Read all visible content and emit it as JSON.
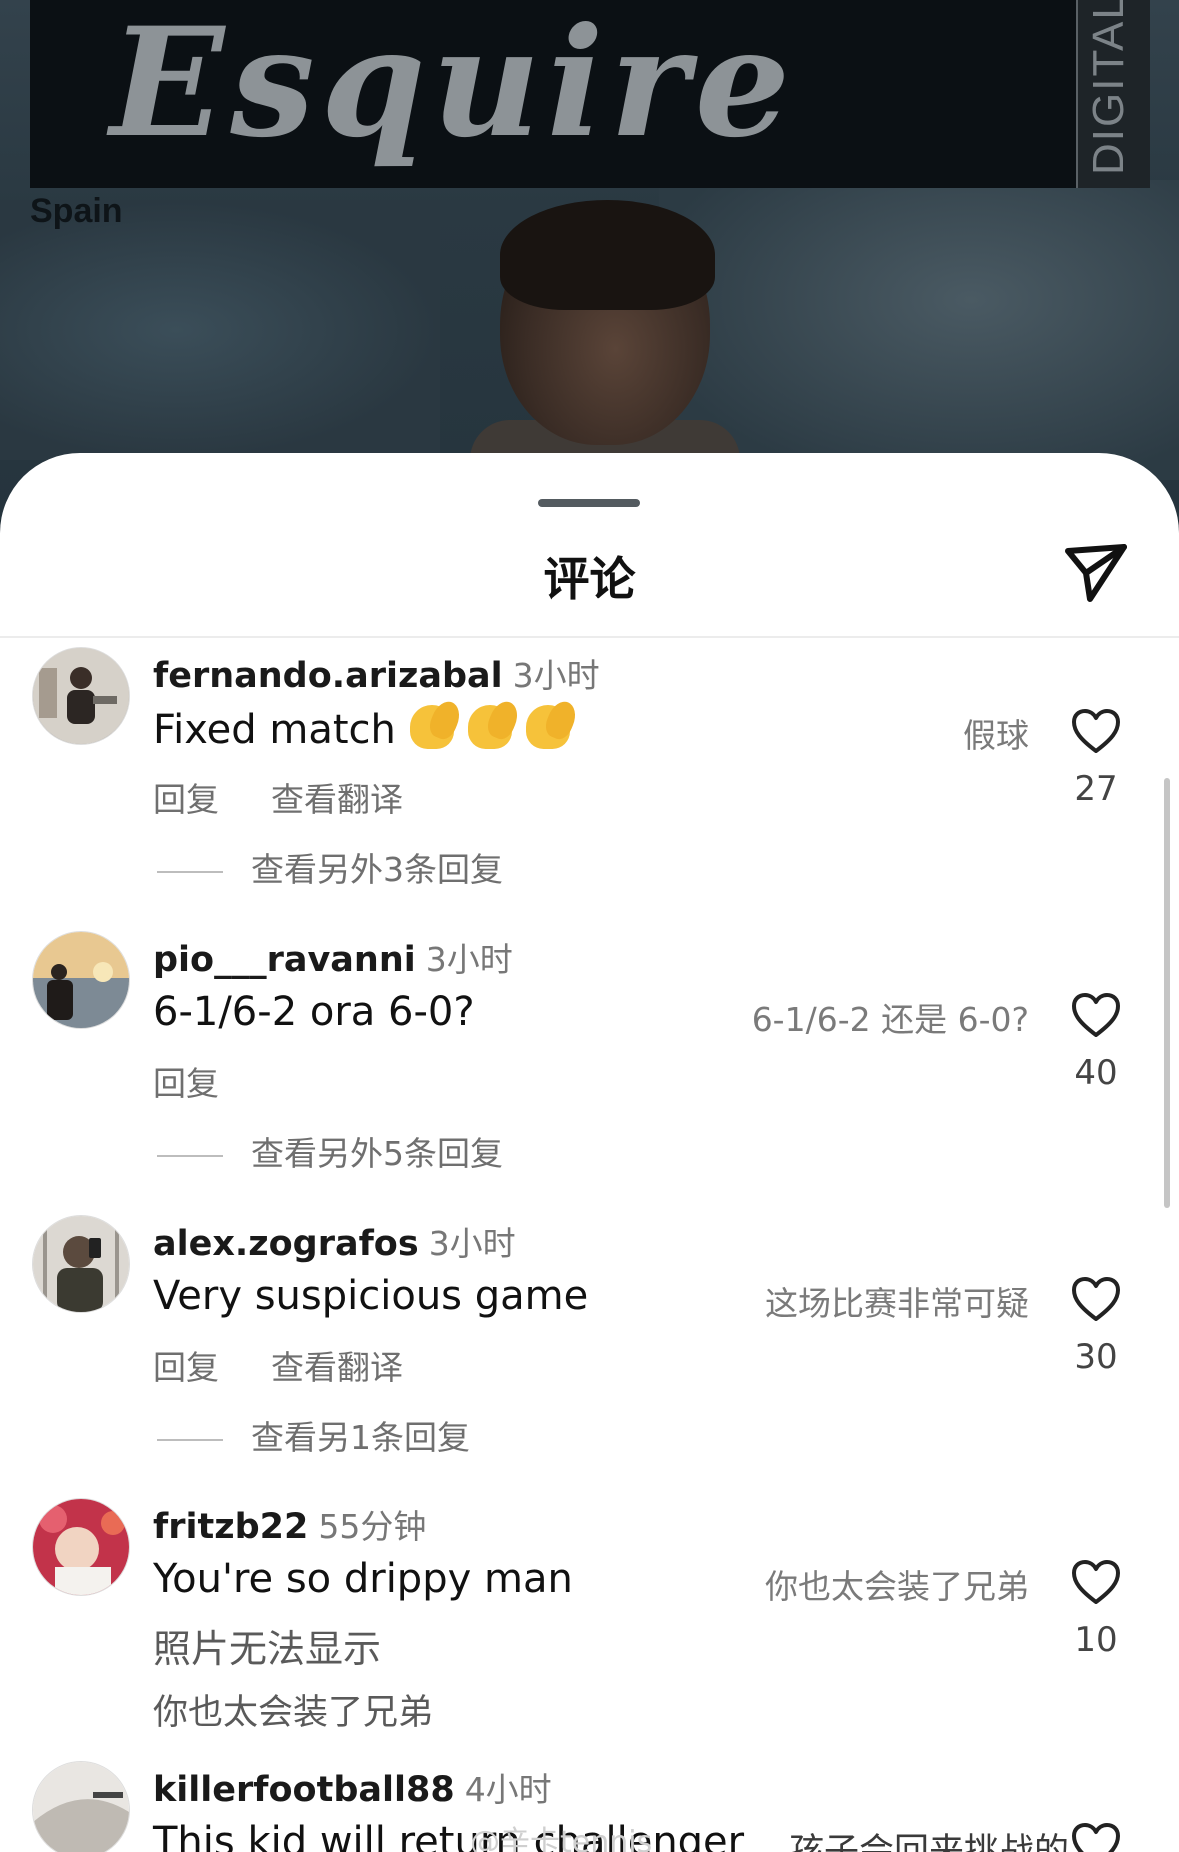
{
  "magazine": {
    "logo": "Esquire",
    "side_label": "DIGITAL",
    "edition": "Spain"
  },
  "sheet": {
    "title": "评论"
  },
  "comments": [
    {
      "username": "fernando.arizabal",
      "time": "3小时",
      "text": "Fixed match",
      "translation": "假球",
      "likes": "27",
      "reply_label": "回复",
      "translate_label": "查看翻译",
      "view_replies": "查看另外3条回复"
    },
    {
      "username": "pio___ravanni",
      "time": "3小时",
      "text": "6-1/6-2 ora 6-0?",
      "translation": "6-1/6-2 还是 6-0?",
      "likes": "40",
      "reply_label": "回复",
      "view_replies": "查看另外5条回复"
    },
    {
      "username": "alex.zografos",
      "time": "3小时",
      "text": "Very suspicious game",
      "translation": "这场比赛非常可疑",
      "likes": "30",
      "reply_label": "回复",
      "translate_label": "查看翻译",
      "view_replies": "查看另1条回复"
    },
    {
      "username": "fritzb22",
      "time": "55分钟",
      "text": "You're so drippy man",
      "translation": "你也太会装了兄弟",
      "likes": "10",
      "photo_note": "照片无法显示",
      "extra_translation": "你也太会装了兄弟"
    },
    {
      "username": "killerfootball88",
      "time": "4小时",
      "text": "This kid will return challenger",
      "translation": "孩子会回来挑战的"
    }
  ],
  "watermark": "@辛卡tennis",
  "icons": {
    "share": "send-icon",
    "like": "heart-icon"
  },
  "colors": {
    "sheet_bg": "#ffffff",
    "muted_text": "#6f6f6f",
    "masthead": "#0b1014"
  }
}
